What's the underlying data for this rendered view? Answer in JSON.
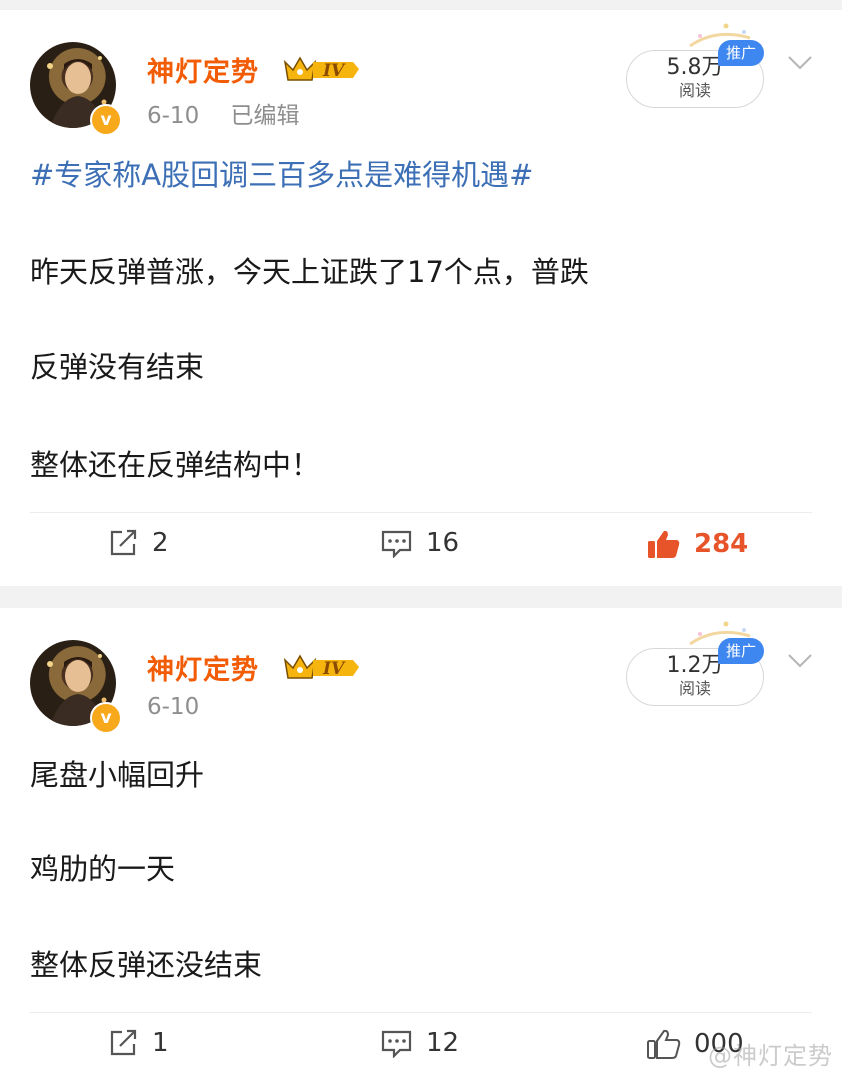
{
  "posts": [
    {
      "username": "神灯定势",
      "badge": "IV",
      "verified_mark": "v",
      "date": "6-10",
      "edited": "已编辑",
      "read_count": "5.8万",
      "read_label": "阅读",
      "promo_label": "推广",
      "hashtag": "#专家称A股回调三百多点是难得机遇#",
      "paragraphs": [
        "昨天反弹普涨，今天上证跌了17个点，普跌",
        "反弹没有结束",
        "整体还在反弹结构中！"
      ],
      "shares": "2",
      "comments": "16",
      "likes": "284",
      "liked": true
    },
    {
      "username": "神灯定势",
      "badge": "IV",
      "verified_mark": "v",
      "date": "6-10",
      "read_count": "1.2万",
      "read_label": "阅读",
      "promo_label": "推广",
      "paragraphs": [
        "尾盘小幅回升",
        "鸡肋的一天",
        "整体反弹还没结束"
      ],
      "shares": "1",
      "comments": "12",
      "likes": "000",
      "liked": false
    }
  ],
  "watermark": "@神灯定势",
  "colors": {
    "username": "#f25c05",
    "hashtag": "#3c6fb5",
    "liked": "#e8542a",
    "promo": "#3f87f0",
    "verified": "#f7a81b"
  },
  "icons": [
    "share-icon",
    "comment-icon",
    "like-icon",
    "chevron-down-icon",
    "crown-icon"
  ]
}
